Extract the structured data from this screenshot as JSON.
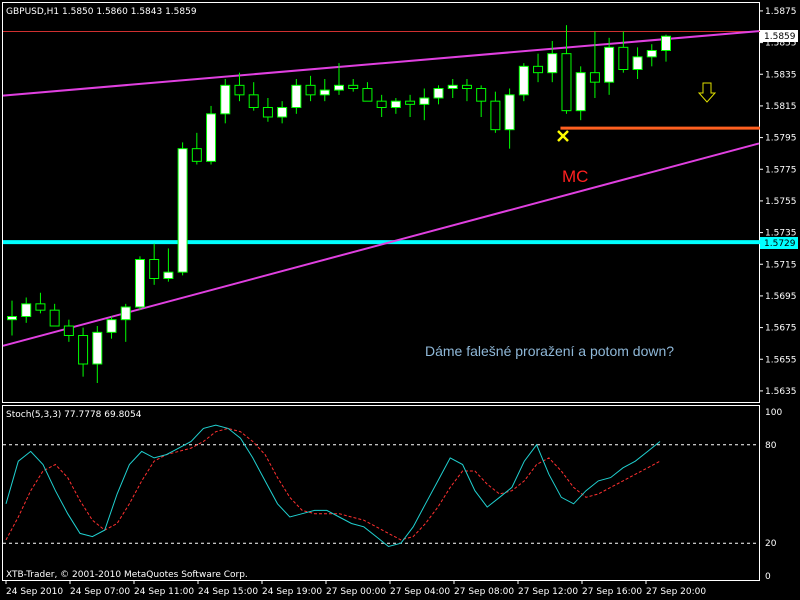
{
  "window": {
    "header_text": "GBPUSD,H1  1.5850 1.5860 1.5843 1.5859",
    "footer_text": "XTB-Trader, © 2001-2010 MetaQuotes Software Corp."
  },
  "colors": {
    "background": "#000000",
    "bull_candle_body": "#ffffff",
    "bear_candle_body": "#000000",
    "candle_wick": "#00ff00",
    "trendline": "#e040e0",
    "support_line": "#00ffff",
    "resistance_line": "#ff6020",
    "top_line": "#d03030",
    "annotation_mc": "#ff2020",
    "annotation_text": "#8fb8d8",
    "marker": "#ffff00",
    "stoch_main": "#20d0d0",
    "stoch_signal": "#ff3030"
  },
  "annotations": {
    "mc_label": "MC",
    "comment": "Dáme falešné proražení a potom down?",
    "marker_icon": "x-marker-icon",
    "arrow_icon": "arrow-down-icon"
  },
  "price_tags": {
    "current": "1.5859",
    "support": "1.5729"
  },
  "stoch_header": "Stoch(5,3,3) 77.7778 69.8054",
  "chart_data": {
    "type": "candlestick",
    "symbol": "GBPUSD",
    "timeframe": "H1",
    "y_ticks": [
      "1.5875",
      "1.5855",
      "1.5835",
      "1.5815",
      "1.5795",
      "1.5775",
      "1.5755",
      "1.5735",
      "1.5715",
      "1.5695",
      "1.5675",
      "1.5655",
      "1.5635"
    ],
    "ylim": [
      1.5628,
      1.588
    ],
    "x_ticks": [
      "24 Sep 2010",
      "24 Sep 07:00",
      "24 Sep 11:00",
      "24 Sep 15:00",
      "24 Sep 19:00",
      "27 Sep 00:00",
      "27 Sep 04:00",
      "27 Sep 08:00",
      "27 Sep 12:00",
      "27 Sep 16:00",
      "27 Sep 20:00"
    ],
    "candles": [
      {
        "o": 1.568,
        "h": 1.5692,
        "l": 1.567,
        "c": 1.5682
      },
      {
        "o": 1.5682,
        "h": 1.5694,
        "l": 1.5678,
        "c": 1.569
      },
      {
        "o": 1.569,
        "h": 1.5697,
        "l": 1.5684,
        "c": 1.5686
      },
      {
        "o": 1.5686,
        "h": 1.569,
        "l": 1.5676,
        "c": 1.5676
      },
      {
        "o": 1.5676,
        "h": 1.568,
        "l": 1.5666,
        "c": 1.567
      },
      {
        "o": 1.567,
        "h": 1.5675,
        "l": 1.5644,
        "c": 1.5652
      },
      {
        "o": 1.5652,
        "h": 1.5676,
        "l": 1.564,
        "c": 1.5672
      },
      {
        "o": 1.5672,
        "h": 1.5682,
        "l": 1.5668,
        "c": 1.568
      },
      {
        "o": 1.568,
        "h": 1.569,
        "l": 1.5666,
        "c": 1.5688
      },
      {
        "o": 1.5688,
        "h": 1.572,
        "l": 1.5686,
        "c": 1.5718
      },
      {
        "o": 1.5718,
        "h": 1.5728,
        "l": 1.5702,
        "c": 1.5706
      },
      {
        "o": 1.5706,
        "h": 1.5725,
        "l": 1.5704,
        "c": 1.571
      },
      {
        "o": 1.571,
        "h": 1.5792,
        "l": 1.5708,
        "c": 1.5788
      },
      {
        "o": 1.5788,
        "h": 1.5798,
        "l": 1.5778,
        "c": 1.578
      },
      {
        "o": 1.578,
        "h": 1.5815,
        "l": 1.5778,
        "c": 1.581
      },
      {
        "o": 1.581,
        "h": 1.5832,
        "l": 1.5804,
        "c": 1.5828
      },
      {
        "o": 1.5828,
        "h": 1.5836,
        "l": 1.5818,
        "c": 1.5822
      },
      {
        "o": 1.5822,
        "h": 1.583,
        "l": 1.5812,
        "c": 1.5814
      },
      {
        "o": 1.5814,
        "h": 1.582,
        "l": 1.5805,
        "c": 1.5808
      },
      {
        "o": 1.5808,
        "h": 1.5818,
        "l": 1.5804,
        "c": 1.5814
      },
      {
        "o": 1.5814,
        "h": 1.5832,
        "l": 1.581,
        "c": 1.5828
      },
      {
        "o": 1.5828,
        "h": 1.5834,
        "l": 1.5818,
        "c": 1.5822
      },
      {
        "o": 1.5822,
        "h": 1.5832,
        "l": 1.5818,
        "c": 1.5825
      },
      {
        "o": 1.5825,
        "h": 1.5842,
        "l": 1.5822,
        "c": 1.5828
      },
      {
        "o": 1.5828,
        "h": 1.5832,
        "l": 1.5824,
        "c": 1.5826
      },
      {
        "o": 1.5826,
        "h": 1.583,
        "l": 1.5818,
        "c": 1.5818
      },
      {
        "o": 1.5818,
        "h": 1.5822,
        "l": 1.5808,
        "c": 1.5814
      },
      {
        "o": 1.5814,
        "h": 1.582,
        "l": 1.581,
        "c": 1.5818
      },
      {
        "o": 1.5818,
        "h": 1.5822,
        "l": 1.5808,
        "c": 1.5816
      },
      {
        "o": 1.5816,
        "h": 1.5826,
        "l": 1.5806,
        "c": 1.582
      },
      {
        "o": 1.582,
        "h": 1.5828,
        "l": 1.5816,
        "c": 1.5826
      },
      {
        "o": 1.5826,
        "h": 1.5832,
        "l": 1.582,
        "c": 1.5828
      },
      {
        "o": 1.5828,
        "h": 1.5832,
        "l": 1.5818,
        "c": 1.5826
      },
      {
        "o": 1.5826,
        "h": 1.5828,
        "l": 1.5808,
        "c": 1.5818
      },
      {
        "o": 1.5818,
        "h": 1.5824,
        "l": 1.5798,
        "c": 1.58
      },
      {
        "o": 1.58,
        "h": 1.5826,
        "l": 1.5788,
        "c": 1.5822
      },
      {
        "o": 1.5822,
        "h": 1.5842,
        "l": 1.5818,
        "c": 1.584
      },
      {
        "o": 1.584,
        "h": 1.5848,
        "l": 1.583,
        "c": 1.5836
      },
      {
        "o": 1.5836,
        "h": 1.5856,
        "l": 1.583,
        "c": 1.5848
      },
      {
        "o": 1.5848,
        "h": 1.5866,
        "l": 1.581,
        "c": 1.5812
      },
      {
        "o": 1.5812,
        "h": 1.584,
        "l": 1.5806,
        "c": 1.5836
      },
      {
        "o": 1.5836,
        "h": 1.5862,
        "l": 1.582,
        "c": 1.583
      },
      {
        "o": 1.583,
        "h": 1.5858,
        "l": 1.5822,
        "c": 1.5852
      },
      {
        "o": 1.5852,
        "h": 1.5862,
        "l": 1.5836,
        "c": 1.5838
      },
      {
        "o": 1.5838,
        "h": 1.5852,
        "l": 1.5832,
        "c": 1.5846
      },
      {
        "o": 1.5846,
        "h": 1.5854,
        "l": 1.584,
        "c": 1.585
      },
      {
        "o": 1.585,
        "h": 1.586,
        "l": 1.5843,
        "c": 1.5859
      }
    ],
    "horizontal_lines": [
      {
        "name": "support",
        "price": 1.5729
      },
      {
        "name": "top",
        "price": 1.5862
      }
    ],
    "resistance_segment": {
      "price": 1.5801,
      "from_index": 39
    },
    "trendlines": [
      {
        "name": "upper",
        "p1": [
          0,
          1.5822
        ],
        "p2": [
          47,
          1.5858
        ]
      },
      {
        "name": "lower",
        "p1": [
          0,
          1.5665
        ],
        "p2": [
          47,
          1.5778
        ]
      }
    ],
    "stochastic": {
      "params": "5,3,3",
      "main": 77.7778,
      "signal": 69.8054,
      "levels": [
        20,
        80
      ],
      "ylim": [
        0,
        100
      ],
      "y_ticks": [
        "100",
        "80",
        "20",
        "0"
      ],
      "main_values": [
        44,
        70,
        76,
        68,
        52,
        38,
        26,
        24,
        28,
        50,
        68,
        76,
        72,
        74,
        78,
        82,
        90,
        92,
        90,
        84,
        72,
        58,
        44,
        36,
        38,
        40,
        40,
        36,
        32,
        30,
        24,
        18,
        20,
        30,
        44,
        58,
        72,
        68,
        52,
        42,
        48,
        54,
        70,
        80,
        62,
        48,
        44,
        52,
        58,
        60,
        66,
        70,
        76,
        82
      ],
      "signal_values": [
        22,
        36,
        52,
        64,
        68,
        60,
        46,
        34,
        28,
        32,
        44,
        58,
        70,
        74,
        76,
        78,
        82,
        88,
        90,
        88,
        82,
        74,
        60,
        48,
        40,
        38,
        38,
        38,
        36,
        34,
        30,
        26,
        22,
        24,
        32,
        42,
        54,
        64,
        64,
        56,
        50,
        52,
        58,
        68,
        72,
        64,
        54,
        48,
        50,
        54,
        58,
        62,
        66,
        70
      ]
    }
  }
}
